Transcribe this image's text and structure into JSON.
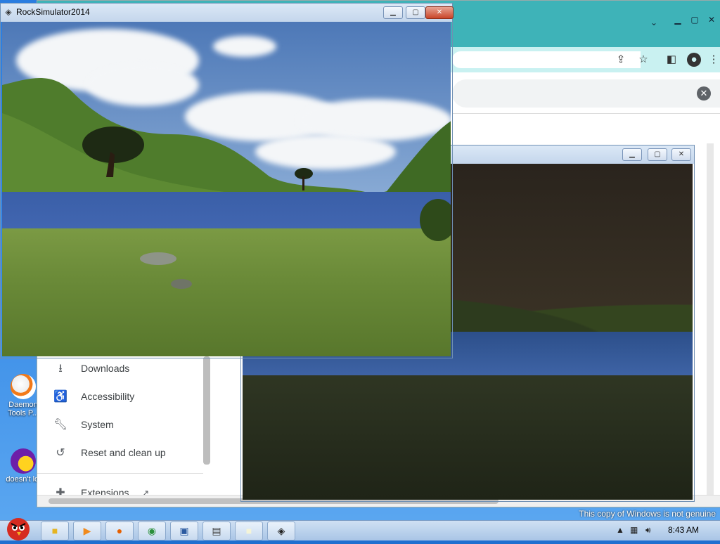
{
  "desktop": {
    "watermark": "This copy of Windows is not genuine",
    "icons": [
      {
        "label": "Daemon Tools P...",
        "icon": "lightning-icon"
      },
      {
        "label": "doesn't lol",
        "icon": "yahoo-messenger-icon"
      }
    ]
  },
  "chrome": {
    "menu": [
      {
        "label": "Downloads",
        "icon": "download-icon"
      },
      {
        "label": "Accessibility",
        "icon": "accessibility-icon"
      },
      {
        "label": "System",
        "icon": "wrench-icon"
      },
      {
        "label": "Reset and clean up",
        "icon": "history-icon"
      },
      {
        "label": "Extensions",
        "icon": "puzzle-icon"
      }
    ]
  },
  "game_window": {
    "title": "RockSimulator2014",
    "minimize": "▁",
    "maximize": "▢",
    "close": "✕"
  },
  "game_window_2": {
    "minimize": "▁",
    "maximize": "▢",
    "close": "✕"
  },
  "taskbar": {
    "clock": "8:43 AM",
    "apps": [
      "folder-icon",
      "media-player-icon",
      "firefox-icon",
      "chrome-icon",
      "network-icon",
      "calendar-icon",
      "blank-window-icon",
      "unity-icon"
    ]
  },
  "colors": {
    "sky": "#5d86c4",
    "water": "#3f67b3",
    "grass": "#6b8a3a",
    "hill": "#4f7c2c",
    "chrome_tab": "#3eb3b8",
    "chrome_toolbar": "#c9f1f1"
  }
}
